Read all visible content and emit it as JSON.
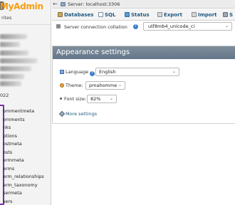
{
  "sidebar": {
    "logo": "MyAdmin",
    "favorites": "rites",
    "db_prefix": "022",
    "tables": [
      "ommentmeta",
      "omments",
      "nks",
      "ptions",
      "ostmeta",
      "osts",
      "ermmeta",
      "erms",
      "erm_relationships",
      "erm_taxonomy",
      "sermeta",
      "sers"
    ]
  },
  "breadcrumb": {
    "server": "Server: localhost:3306"
  },
  "tabs": {
    "databases": "Databases",
    "sql": "SQL",
    "status": "Status",
    "export": "Export",
    "import": "Import",
    "settings": "S"
  },
  "collation": {
    "label": "Server connection collation",
    "value": "utf8mb4_unicode_ci"
  },
  "appearance": {
    "title": "Appearance settings",
    "language_label": "Language",
    "language_value": "English",
    "theme_label": "Theme:",
    "theme_value": "pmahomme",
    "font_label": "Font size:",
    "font_value": "82%",
    "more": "More settings"
  },
  "colors": {
    "link": "#235a81",
    "header": "#6c7b8b",
    "logo": "#f89c0e",
    "highlight": "#7b2ea6"
  }
}
